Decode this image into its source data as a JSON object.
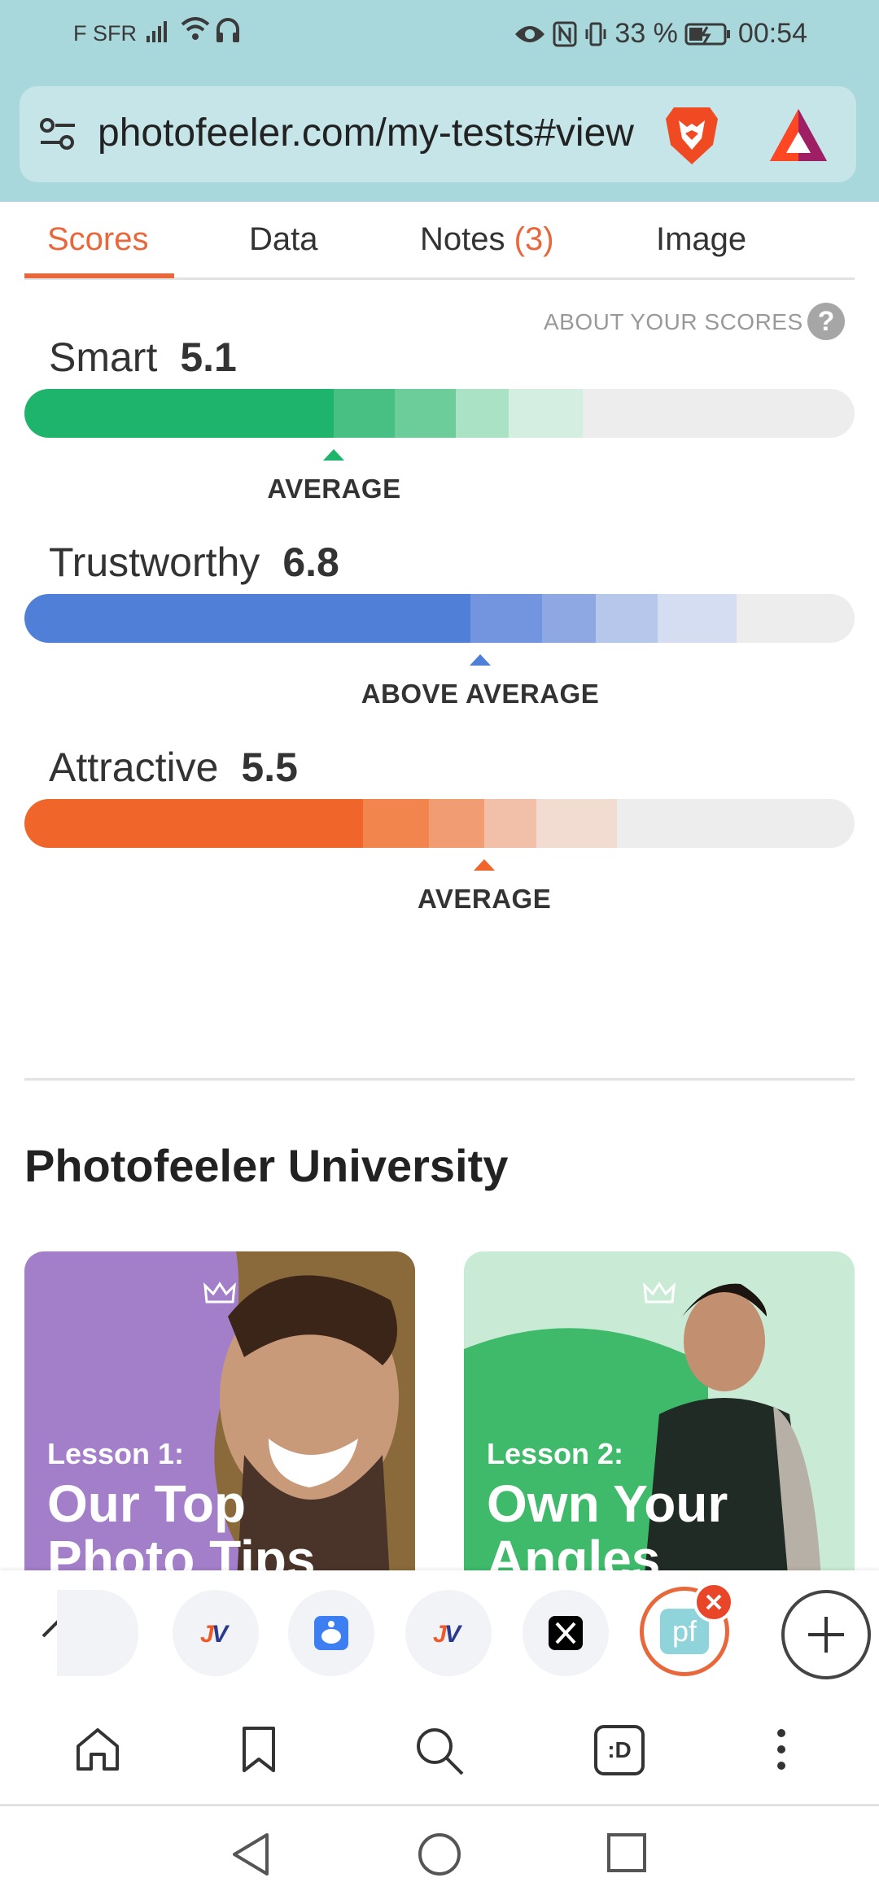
{
  "status_bar": {
    "carrier": "F SFR",
    "battery": "33 %",
    "time": "00:54",
    "icons": [
      "signal-icon",
      "wifi-icon",
      "headset-icon",
      "eye-icon",
      "nfc-icon",
      "vibrate-icon",
      "battery-icon"
    ]
  },
  "browser": {
    "url": "photofeeler.com/my-tests#view",
    "shield_icon": "brave-lion-icon",
    "rewards_icon": "bat-triangle-icon"
  },
  "tabs": [
    {
      "label": "Scores",
      "active": true
    },
    {
      "label": "Data",
      "active": false
    },
    {
      "label": "Notes",
      "count": "(3)",
      "active": false
    },
    {
      "label": "Image",
      "active": false
    }
  ],
  "about_scores": "ABOUT YOUR SCORES",
  "help_glyph": "?",
  "scores": [
    {
      "label": "Smart",
      "value": "5.1",
      "verdict": "AVERAGE",
      "level": 0.373,
      "band_ends": [
        0.373,
        0.446,
        0.52,
        0.583,
        0.673
      ],
      "colors": [
        "#1fb46c",
        "#48c083",
        "#6ccd9b",
        "#a9e2c4",
        "#d4efe1"
      ]
    },
    {
      "label": "Trustworthy",
      "value": "6.8",
      "verdict": "ABOVE AVERAGE",
      "level": 0.549,
      "band_ends": [
        0.537,
        0.624,
        0.688,
        0.763,
        0.858
      ],
      "colors": [
        "#4f7fd7",
        "#7394df",
        "#8ea8e4",
        "#b7c7ec",
        "#d4ddf1"
      ]
    },
    {
      "label": "Attractive",
      "value": "5.5",
      "verdict": "AVERAGE",
      "level": 0.554,
      "band_ends": [
        0.408,
        0.487,
        0.554,
        0.617,
        0.714
      ],
      "colors": [
        "#f0652a",
        "#f2844e",
        "#f29c74",
        "#f2c0a8",
        "#f2dbd0"
      ]
    }
  ],
  "university": {
    "title": "Photofeeler University",
    "lessons": [
      {
        "number": "Lesson 1:",
        "title": "Our Top Photo Tips",
        "bg": "#a37fc9",
        "accent": "#8c63b8"
      },
      {
        "number": "Lesson 2:",
        "title": "Own Your Angles",
        "bg": "#c9ebd5",
        "accent": "#3fb96a"
      }
    ]
  },
  "tab_strip": {
    "collapse_icon": "chevron-up-icon",
    "tabs": [
      {
        "name": "jv-tab",
        "icon": "jv-icon"
      },
      {
        "name": "reddit-tab",
        "icon": "reddit-icon"
      },
      {
        "name": "jv-tab-2",
        "icon": "jv-icon"
      },
      {
        "name": "x-tab",
        "icon": "x-icon"
      },
      {
        "name": "photofeeler-tab",
        "icon": "pf-icon",
        "glyph": "pf"
      }
    ],
    "new_tab_icon": "plus-icon"
  },
  "bottom_nav": [
    "home-icon",
    "bookmark-icon",
    "search-icon",
    "tabs-icon",
    "more-icon"
  ],
  "tabs_glyph": ":D",
  "system_nav": [
    "back-icon",
    "home-circle-icon",
    "recents-icon"
  ]
}
